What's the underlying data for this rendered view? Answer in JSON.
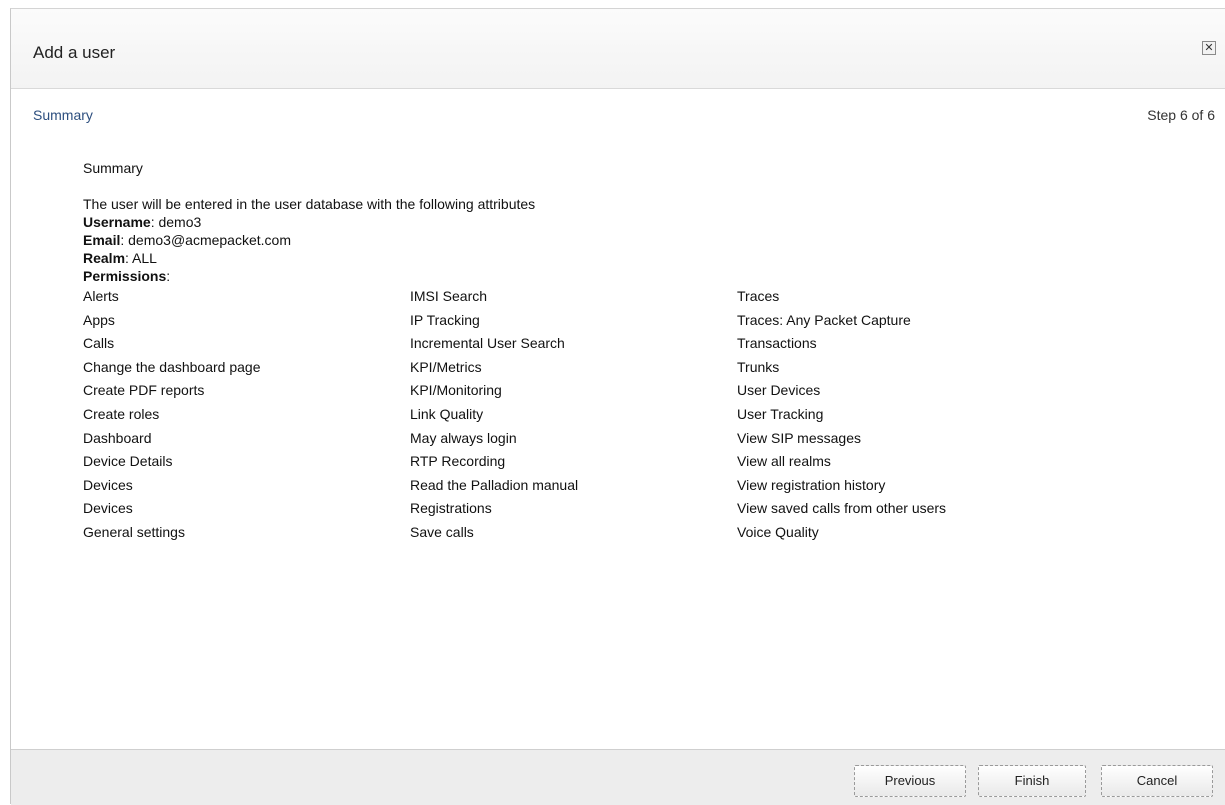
{
  "dialog": {
    "title": "Add a user",
    "close_glyph": "✕",
    "close_icon": "close-icon"
  },
  "step": {
    "name": "Summary",
    "count": "Step 6 of 6"
  },
  "summary": {
    "heading": "Summary",
    "intro": "The user will be entered in the user database with the following attributes",
    "username_label": "Username",
    "username_value": ": demo3",
    "email_label": "Email",
    "email_value": ": demo3@acmepacket.com",
    "realm_label": "Realm",
    "realm_value": ": ALL",
    "permissions_label": "Permissions",
    "permissions_colon": ":"
  },
  "permissions": {
    "col1": [
      "Alerts",
      "Apps",
      "Calls",
      "Change the dashboard page",
      "Create PDF reports",
      "Create roles",
      "Dashboard",
      "Device Details",
      "Devices",
      "Devices",
      "General settings"
    ],
    "col2": [
      "IMSI Search",
      "IP Tracking",
      "Incremental User Search",
      "KPI/Metrics",
      "KPI/Monitoring",
      "Link Quality",
      "May always login",
      "RTP Recording",
      "Read the Palladion manual",
      "Registrations",
      "Save calls"
    ],
    "col3": [
      "Traces",
      "Traces: Any Packet Capture",
      "Transactions",
      "Trunks",
      "User Devices",
      "User Tracking",
      "View SIP messages",
      "View all realms",
      "View registration history",
      "View saved calls from other users",
      "Voice Quality"
    ]
  },
  "buttons": {
    "previous": "Previous",
    "finish": "Finish",
    "cancel": "Cancel"
  },
  "colors": {
    "step_link": "#2d4f7f",
    "footer_bg": "#ededed"
  }
}
